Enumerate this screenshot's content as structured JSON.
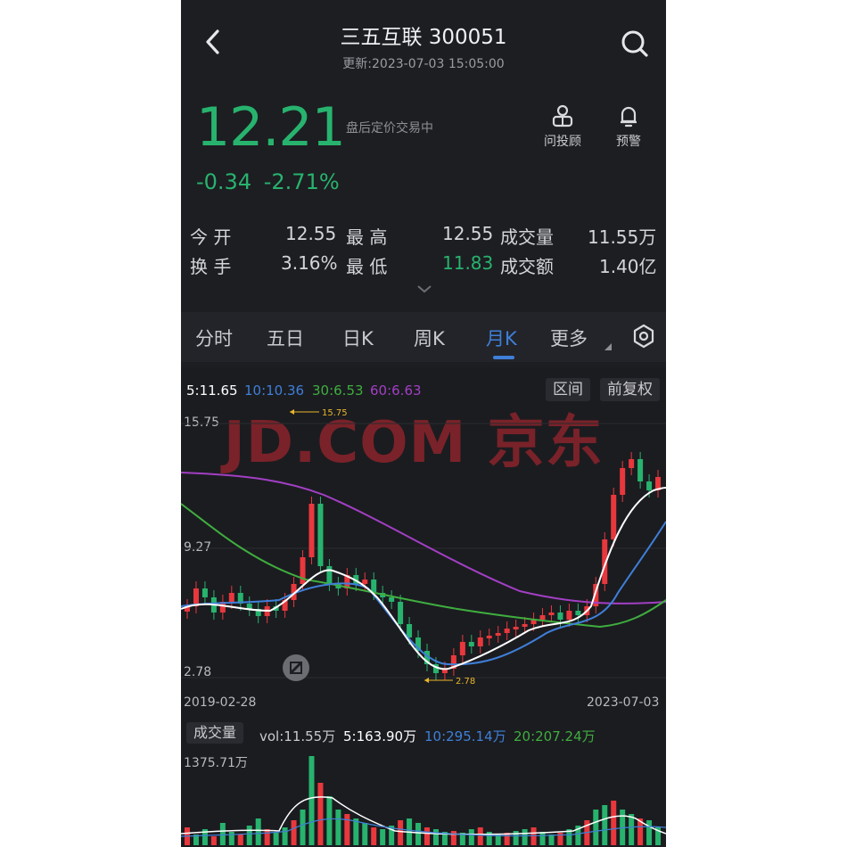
{
  "header": {
    "title": "三五互联 300051",
    "updated": "更新:2023-07-03 15:05:00"
  },
  "quote": {
    "price": "12.21",
    "status": "盘后定价交易中",
    "change": "-0.34",
    "change_pct": "-2.71%"
  },
  "actions": {
    "advisor": "问投顾",
    "alert": "预警"
  },
  "stats": {
    "open_label": "今 开",
    "open": "12.55",
    "high_label": "最 高",
    "high": "12.55",
    "vol_label": "成交量",
    "vol": "11.55万",
    "turnover_label": "换 手",
    "turnover": "3.16%",
    "low_label": "最 低",
    "low": "11.83",
    "amount_label": "成交额",
    "amount": "1.40亿"
  },
  "tabs": [
    "分时",
    "五日",
    "日K",
    "周K",
    "月K",
    "更多"
  ],
  "active_tab": "月K",
  "ma_legend": {
    "ma5": "5:11.65",
    "ma10": "10:10.36",
    "ma30": "30:6.53",
    "ma60": "60:6.63"
  },
  "chips": {
    "range": "区间",
    "adjust": "前复权"
  },
  "axis": {
    "high": "15.75",
    "mid": "9.27",
    "low": "2.78",
    "start_date": "2019-02-28",
    "end_date": "2023-07-03",
    "max_marker": "15.75",
    "min_marker": "2.78"
  },
  "watermark": "JD.COM 京东",
  "volume": {
    "selector": "成交量",
    "vol": "vol:11.55万",
    "ma5": "5:163.90万",
    "ma10": "10:295.14万",
    "ma20": "20:207.24万",
    "axis_max": "1375.71万"
  },
  "colors": {
    "up": "#e8383d",
    "down": "#27b36e",
    "ma5": "#ffffff",
    "ma10": "#3f7fd8",
    "ma30": "#3fae3f",
    "ma60": "#a23fc4",
    "accent": "#3f7fd8"
  }
}
